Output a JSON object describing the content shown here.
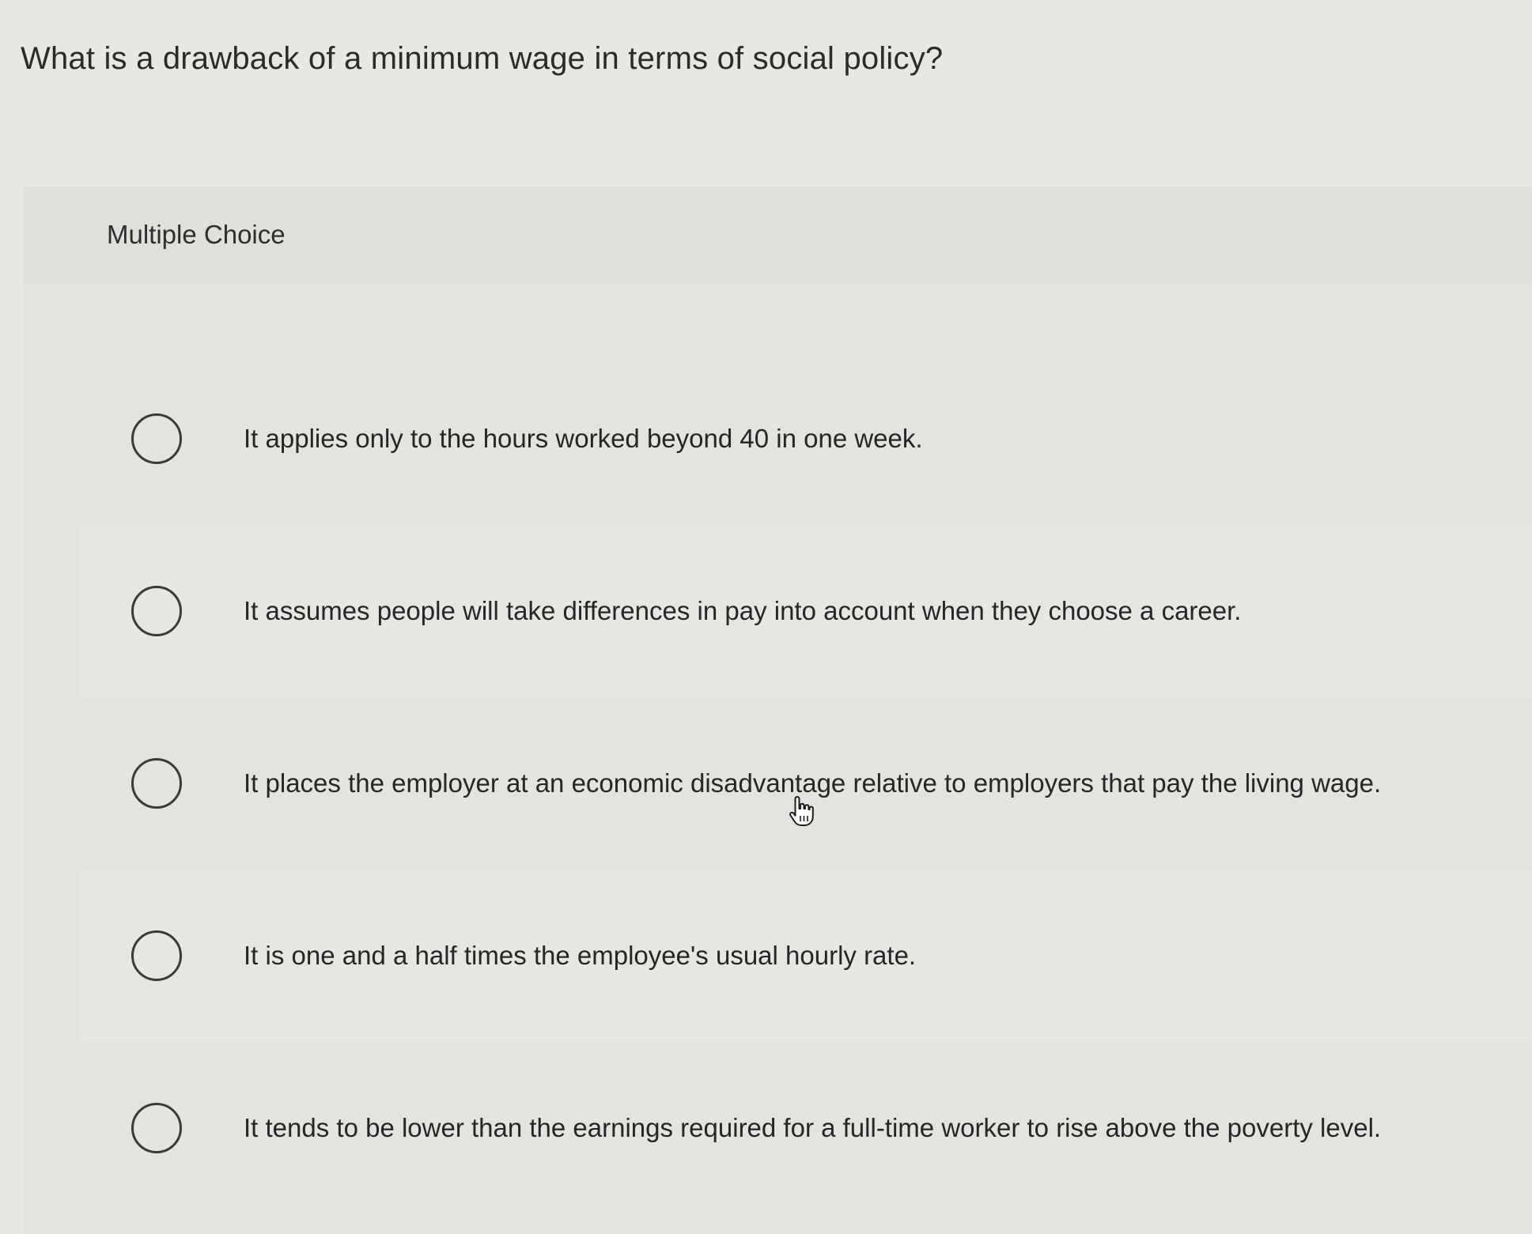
{
  "question": "What is a drawback of a minimum wage in terms of social policy?",
  "section_label": "Multiple Choice",
  "options": [
    {
      "label": "It applies only to the hours worked beyond 40 in one week."
    },
    {
      "label": "It assumes people will take differences in pay into account when they choose a career."
    },
    {
      "label": "It places the employer at an economic disadvantage relative to employers that pay the living wage."
    },
    {
      "label": "It is one and a half times the employee's usual hourly rate."
    },
    {
      "label": "It tends to be lower than the earnings required for a full-time worker to rise above the poverty level."
    }
  ],
  "cursor_icon": "hand-pointer-icon",
  "colors": {
    "background": "#e9e7e1",
    "panel": "#e4e3df",
    "text": "#2a2a2a",
    "radio_border": "#3a3a3a"
  }
}
